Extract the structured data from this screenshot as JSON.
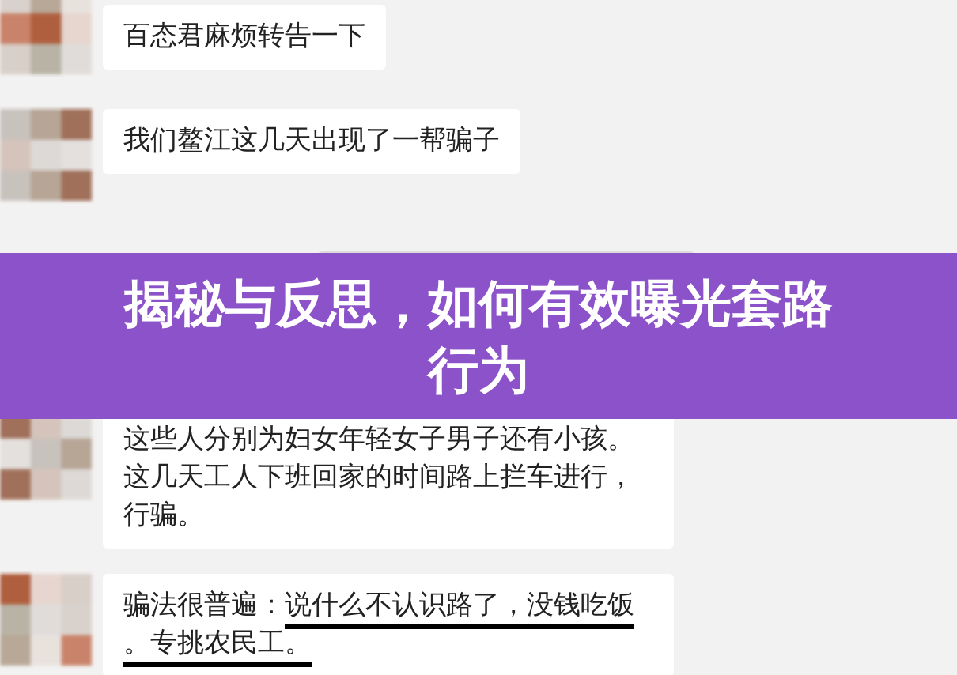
{
  "messages": [
    {
      "text": "百态君麻烦转告一下"
    },
    {
      "text": "我们鳌江这几天出现了一帮骗子"
    },
    {
      "kind": "notice"
    },
    {
      "text": "这些人分别为妇女年轻女子男子还有小孩。这几天工人下班回家的时间路上拦车进行，行骗。"
    },
    {
      "text": "骗法很普遍：",
      "underlined": "说什么不认识路了，没钱吃饭。专挑农民工。"
    }
  ],
  "banner": {
    "title": "揭秘与反思，如何有效曝光套路行为"
  }
}
